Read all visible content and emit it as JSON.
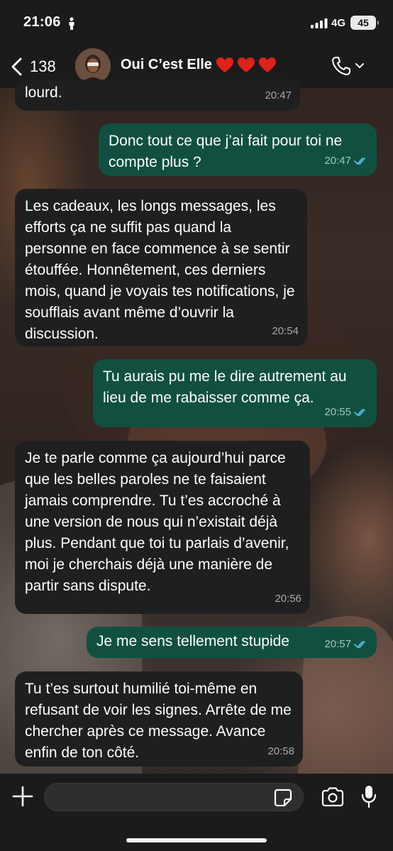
{
  "status_bar": {
    "time": "21:06",
    "network": "4G",
    "battery": "45"
  },
  "header": {
    "back_count": "138",
    "contact_name": "Oui C’est Elle",
    "hearts": [
      "❤️",
      "❤️",
      "❤️"
    ]
  },
  "messages": [
    {
      "direction": "incoming",
      "text": "lourd.",
      "time": "20:47"
    },
    {
      "direction": "outgoing",
      "text": "Donc tout ce que j’ai fait pour toi ne compte plus ?",
      "time": "20:47",
      "read": true
    },
    {
      "direction": "incoming",
      "text": "Les cadeaux, les longs messages, les efforts ça ne suffit pas quand la personne en face commence à se sentir étouffée. Honnêtement, ces derniers mois, quand je voyais tes notifications, je soufflais avant même d’ouvrir la discussion.",
      "time": "20:54"
    },
    {
      "direction": "outgoing",
      "text": "Tu aurais pu me le dire autrement au lieu de me rabaisser comme ça.",
      "time": "20:55",
      "read": true
    },
    {
      "direction": "incoming",
      "text": "Je te parle comme ça aujourd’hui parce que les belles paroles ne te faisaient jamais comprendre. Tu t’es accroché à une version de nous qui n’existait déjà plus. Pendant que toi tu parlais d’avenir, moi je cherchais déjà une manière de partir sans dispute.",
      "time": "20:56"
    },
    {
      "direction": "outgoing",
      "text": "Je me sens tellement stupide",
      "time": "20:57",
      "read": true
    },
    {
      "direction": "incoming",
      "text": "Tu t’es surtout humilié toi-même en refusant de voir les signes. Arrête de me chercher après ce message. Avance enfin de ton côté.",
      "time": "20:58"
    }
  ],
  "composer": {
    "input_value": ""
  },
  "colors": {
    "incoming_bubble": "#1f1f1f",
    "outgoing_bubble": "#115040",
    "read_ticks": "#53bdeb",
    "bars": "#1b1b1b"
  }
}
